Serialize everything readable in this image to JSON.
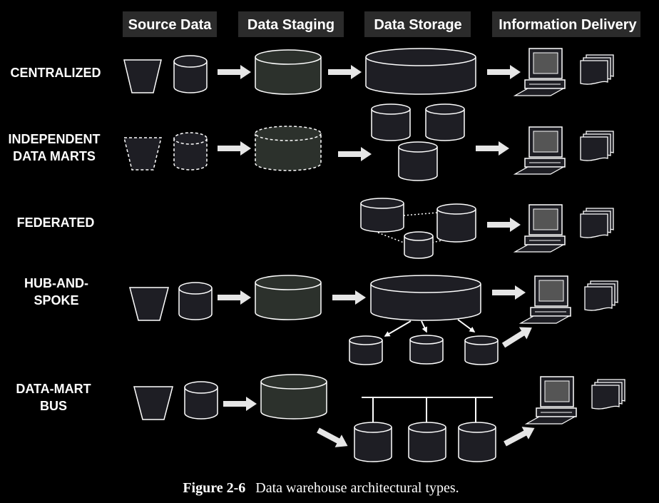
{
  "headers": {
    "source_data": "Source Data",
    "data_staging": "Data Staging",
    "data_storage": "Data Storage",
    "information_delivery": "Information Delivery"
  },
  "rows": {
    "centralized": "CENTRALIZED",
    "independent_1": "INDEPENDENT",
    "independent_2": "DATA MARTS",
    "federated": "FEDERATED",
    "hub_1": "HUB-AND-",
    "hub_2": "SPOKE",
    "bus_1": "DATA-MART",
    "bus_2": "BUS"
  },
  "caption": {
    "figure": "Figure 2-6",
    "text": "Data warehouse architectural types."
  },
  "colors": {
    "background": "#000000",
    "header_fill": "#2b2b2b",
    "cylinder_fill": "#1e1e24",
    "staging_fill": "#2c312c",
    "stroke": "#ffffff",
    "arrow": "#e6e6e6"
  },
  "icons": {
    "source": "funnel-icon",
    "database": "database-icon",
    "computer": "computer-icon",
    "report": "report-stack-icon"
  }
}
